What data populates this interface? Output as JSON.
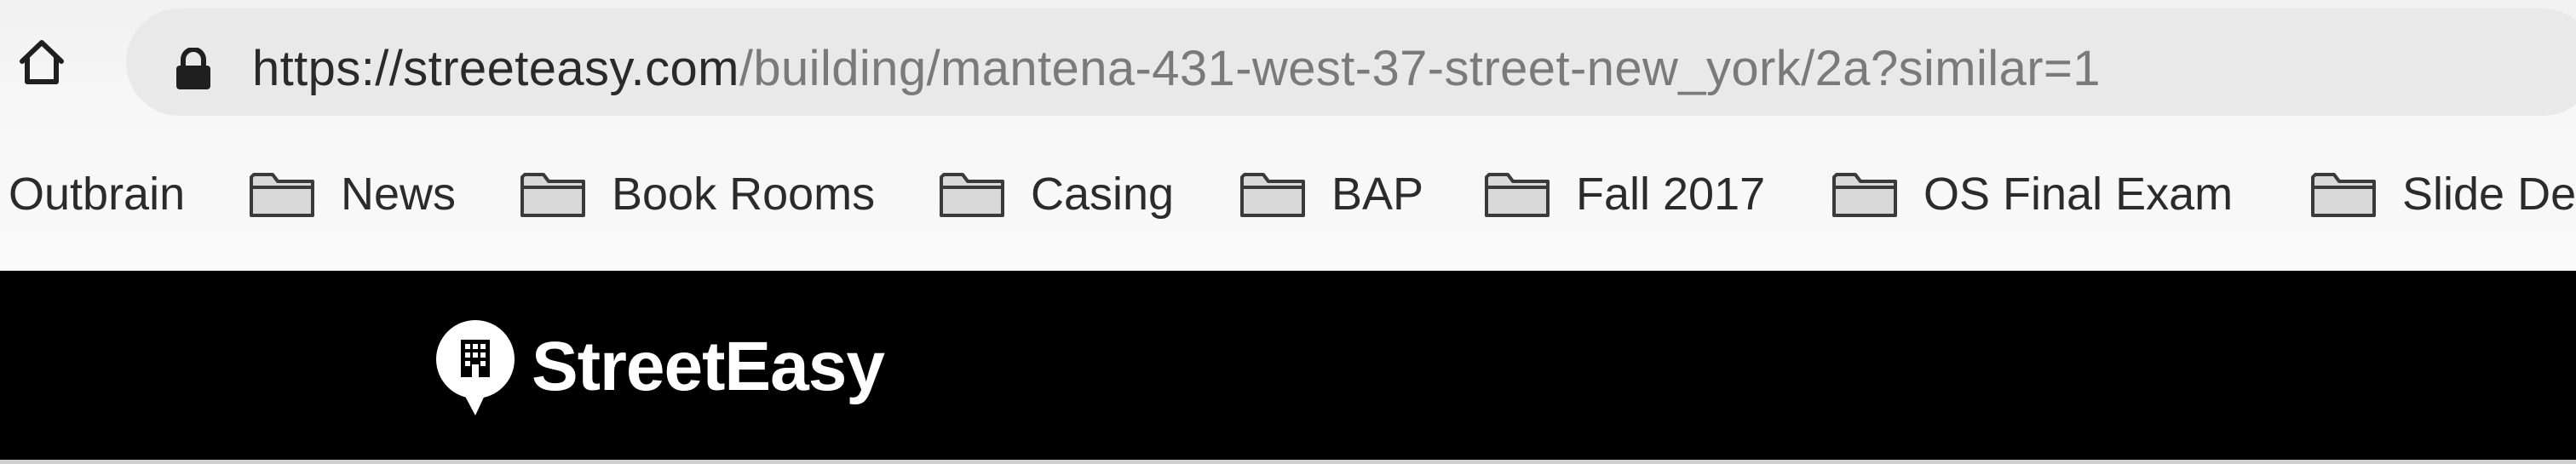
{
  "browser": {
    "home_icon": "home-icon",
    "lock_icon": "lock-icon",
    "url_host": "https://streeteasy.com",
    "url_path": "/building/mantena-431-west-37-street-new_york/2a?similar=1"
  },
  "bookmarks": {
    "folder_icon": "folder-icon",
    "items": [
      {
        "label": "Outbrain"
      },
      {
        "label": "News"
      },
      {
        "label": "Book Rooms"
      },
      {
        "label": "Casing"
      },
      {
        "label": "BAP"
      },
      {
        "label": "Fall 2017"
      },
      {
        "label": "OS Final Exam"
      },
      {
        "label": "Slide De"
      }
    ]
  },
  "site": {
    "brand_name": "StreetEasy",
    "logo_icon": "building-speech-bubble-icon",
    "header_color": "#000000",
    "brand_color": "#ffffff"
  }
}
